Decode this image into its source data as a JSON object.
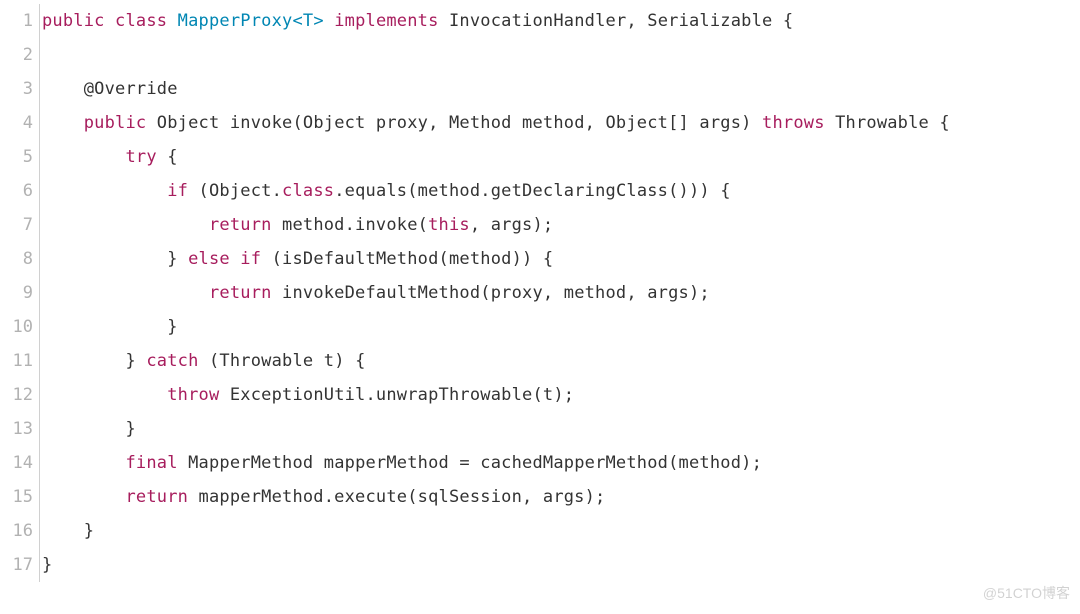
{
  "watermark": "@51CTO博客",
  "colors": {
    "keyword": "#a71d5d",
    "classref": "#0086b3",
    "text": "#333333",
    "gutter": "#b2b2b2"
  },
  "code": {
    "language": "java",
    "lines": [
      {
        "n": 1,
        "tokens": [
          {
            "t": "keyword",
            "v": "public"
          },
          {
            "t": "plain",
            "v": " "
          },
          {
            "t": "keyword",
            "v": "class"
          },
          {
            "t": "plain",
            "v": " "
          },
          {
            "t": "class",
            "v": "MapperProxy<T>"
          },
          {
            "t": "plain",
            "v": " "
          },
          {
            "t": "keyword",
            "v": "implements"
          },
          {
            "t": "plain",
            "v": " InvocationHandler, Serializable {"
          }
        ]
      },
      {
        "n": 2,
        "tokens": [
          {
            "t": "plain",
            "v": ""
          }
        ]
      },
      {
        "n": 3,
        "tokens": [
          {
            "t": "plain",
            "v": "    "
          },
          {
            "t": "annot",
            "v": "@Override"
          }
        ]
      },
      {
        "n": 4,
        "tokens": [
          {
            "t": "plain",
            "v": "    "
          },
          {
            "t": "keyword",
            "v": "public"
          },
          {
            "t": "plain",
            "v": " Object "
          },
          {
            "t": "method",
            "v": "invoke"
          },
          {
            "t": "plain",
            "v": "(Object proxy, Method method, Object[] args) "
          },
          {
            "t": "keyword",
            "v": "throws"
          },
          {
            "t": "plain",
            "v": " Throwable {"
          }
        ]
      },
      {
        "n": 5,
        "tokens": [
          {
            "t": "plain",
            "v": "        "
          },
          {
            "t": "keyword",
            "v": "try"
          },
          {
            "t": "plain",
            "v": " {"
          }
        ]
      },
      {
        "n": 6,
        "tokens": [
          {
            "t": "plain",
            "v": "            "
          },
          {
            "t": "keyword",
            "v": "if"
          },
          {
            "t": "plain",
            "v": " (Object."
          },
          {
            "t": "keyword",
            "v": "class"
          },
          {
            "t": "plain",
            "v": ".equals(method.getDeclaringClass())) {"
          }
        ]
      },
      {
        "n": 7,
        "tokens": [
          {
            "t": "plain",
            "v": "                "
          },
          {
            "t": "keyword",
            "v": "return"
          },
          {
            "t": "plain",
            "v": " method.invoke("
          },
          {
            "t": "this",
            "v": "this"
          },
          {
            "t": "plain",
            "v": ", args);"
          }
        ]
      },
      {
        "n": 8,
        "tokens": [
          {
            "t": "plain",
            "v": "            } "
          },
          {
            "t": "keyword",
            "v": "else"
          },
          {
            "t": "plain",
            "v": " "
          },
          {
            "t": "keyword",
            "v": "if"
          },
          {
            "t": "plain",
            "v": " (isDefaultMethod(method)) {"
          }
        ]
      },
      {
        "n": 9,
        "tokens": [
          {
            "t": "plain",
            "v": "                "
          },
          {
            "t": "keyword",
            "v": "return"
          },
          {
            "t": "plain",
            "v": " invokeDefaultMethod(proxy, method, args);"
          }
        ]
      },
      {
        "n": 10,
        "tokens": [
          {
            "t": "plain",
            "v": "            }"
          }
        ]
      },
      {
        "n": 11,
        "tokens": [
          {
            "t": "plain",
            "v": "        } "
          },
          {
            "t": "keyword",
            "v": "catch"
          },
          {
            "t": "plain",
            "v": " (Throwable t) {"
          }
        ]
      },
      {
        "n": 12,
        "tokens": [
          {
            "t": "plain",
            "v": "            "
          },
          {
            "t": "keyword",
            "v": "throw"
          },
          {
            "t": "plain",
            "v": " ExceptionUtil.unwrapThrowable(t);"
          }
        ]
      },
      {
        "n": 13,
        "tokens": [
          {
            "t": "plain",
            "v": "        }"
          }
        ]
      },
      {
        "n": 14,
        "tokens": [
          {
            "t": "plain",
            "v": "        "
          },
          {
            "t": "keyword",
            "v": "final"
          },
          {
            "t": "plain",
            "v": " MapperMethod mapperMethod = cachedMapperMethod(method);"
          }
        ]
      },
      {
        "n": 15,
        "tokens": [
          {
            "t": "plain",
            "v": "        "
          },
          {
            "t": "keyword",
            "v": "return"
          },
          {
            "t": "plain",
            "v": " mapperMethod.execute(sqlSession, args);"
          }
        ]
      },
      {
        "n": 16,
        "tokens": [
          {
            "t": "plain",
            "v": "    }"
          }
        ]
      },
      {
        "n": 17,
        "tokens": [
          {
            "t": "plain",
            "v": "}"
          }
        ]
      }
    ]
  }
}
